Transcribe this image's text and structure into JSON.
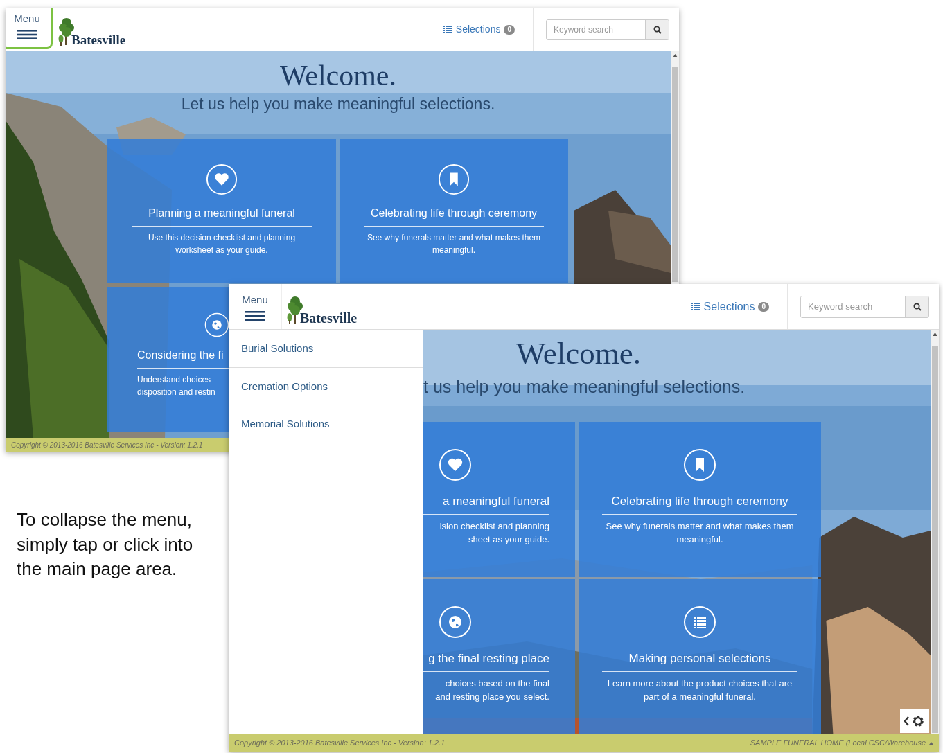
{
  "windows": [
    {
      "header": {
        "menu_label": "Menu",
        "menu_highlighted": true,
        "brand": "Batesville",
        "selections_label": "Selections",
        "selections_count": "0",
        "search_placeholder": "Keyword search"
      },
      "hero": {
        "title": "Welcome.",
        "subtitle": "Let us help you make meaningful selections."
      },
      "tiles": [
        {
          "kind": "planning",
          "title": "Planning a meaningful funeral",
          "description": "Use this decision checklist and planning\nworksheet as your guide."
        },
        {
          "kind": "ceremony",
          "title": "Celebrating life through ceremony",
          "description": "See why funerals matter and what makes them\nmeaningful."
        },
        {
          "kind": "disposition",
          "title": "Considering the fi",
          "description": "Understand choices\ndisposition and restin"
        }
      ],
      "footer": {
        "copyright": "Copyright © 2013-2016 Batesville Services Inc - Version: 1.2.1"
      }
    },
    {
      "header": {
        "menu_label": "Menu",
        "menu_highlighted": false,
        "brand": "Batesville",
        "selections_label": "Selections",
        "selections_count": "0",
        "search_placeholder": "Keyword search"
      },
      "side_menu": [
        {
          "label": "Burial Solutions"
        },
        {
          "label": "Cremation Options"
        },
        {
          "label": "Memorial Solutions"
        }
      ],
      "hero": {
        "title": "Welcome.",
        "subtitle": "t us help you make meaningful selections."
      },
      "tiles": [
        {
          "kind": "planning",
          "title": "a meaningful funeral",
          "description": "ision checklist and planning\nsheet as your guide."
        },
        {
          "kind": "ceremony",
          "title": "Celebrating life through ceremony",
          "description": "See why funerals matter and what makes them\nmeaningful."
        },
        {
          "kind": "disposition",
          "title": "g the final resting place",
          "description": "choices based on the final\nand resting place you select."
        },
        {
          "kind": "selections",
          "title": "Making personal selections",
          "description": "Learn more about the product choices that are\npart of a meaningful funeral."
        }
      ],
      "footer": {
        "copyright": "Copyright © 2013-2016 Batesville Services Inc - Version: 1.2.1",
        "home": "SAMPLE FUNERAL HOME (Local CSC/Warehouse"
      }
    }
  ],
  "caption": "To collapse the menu, simply tap or click into the main page area."
}
